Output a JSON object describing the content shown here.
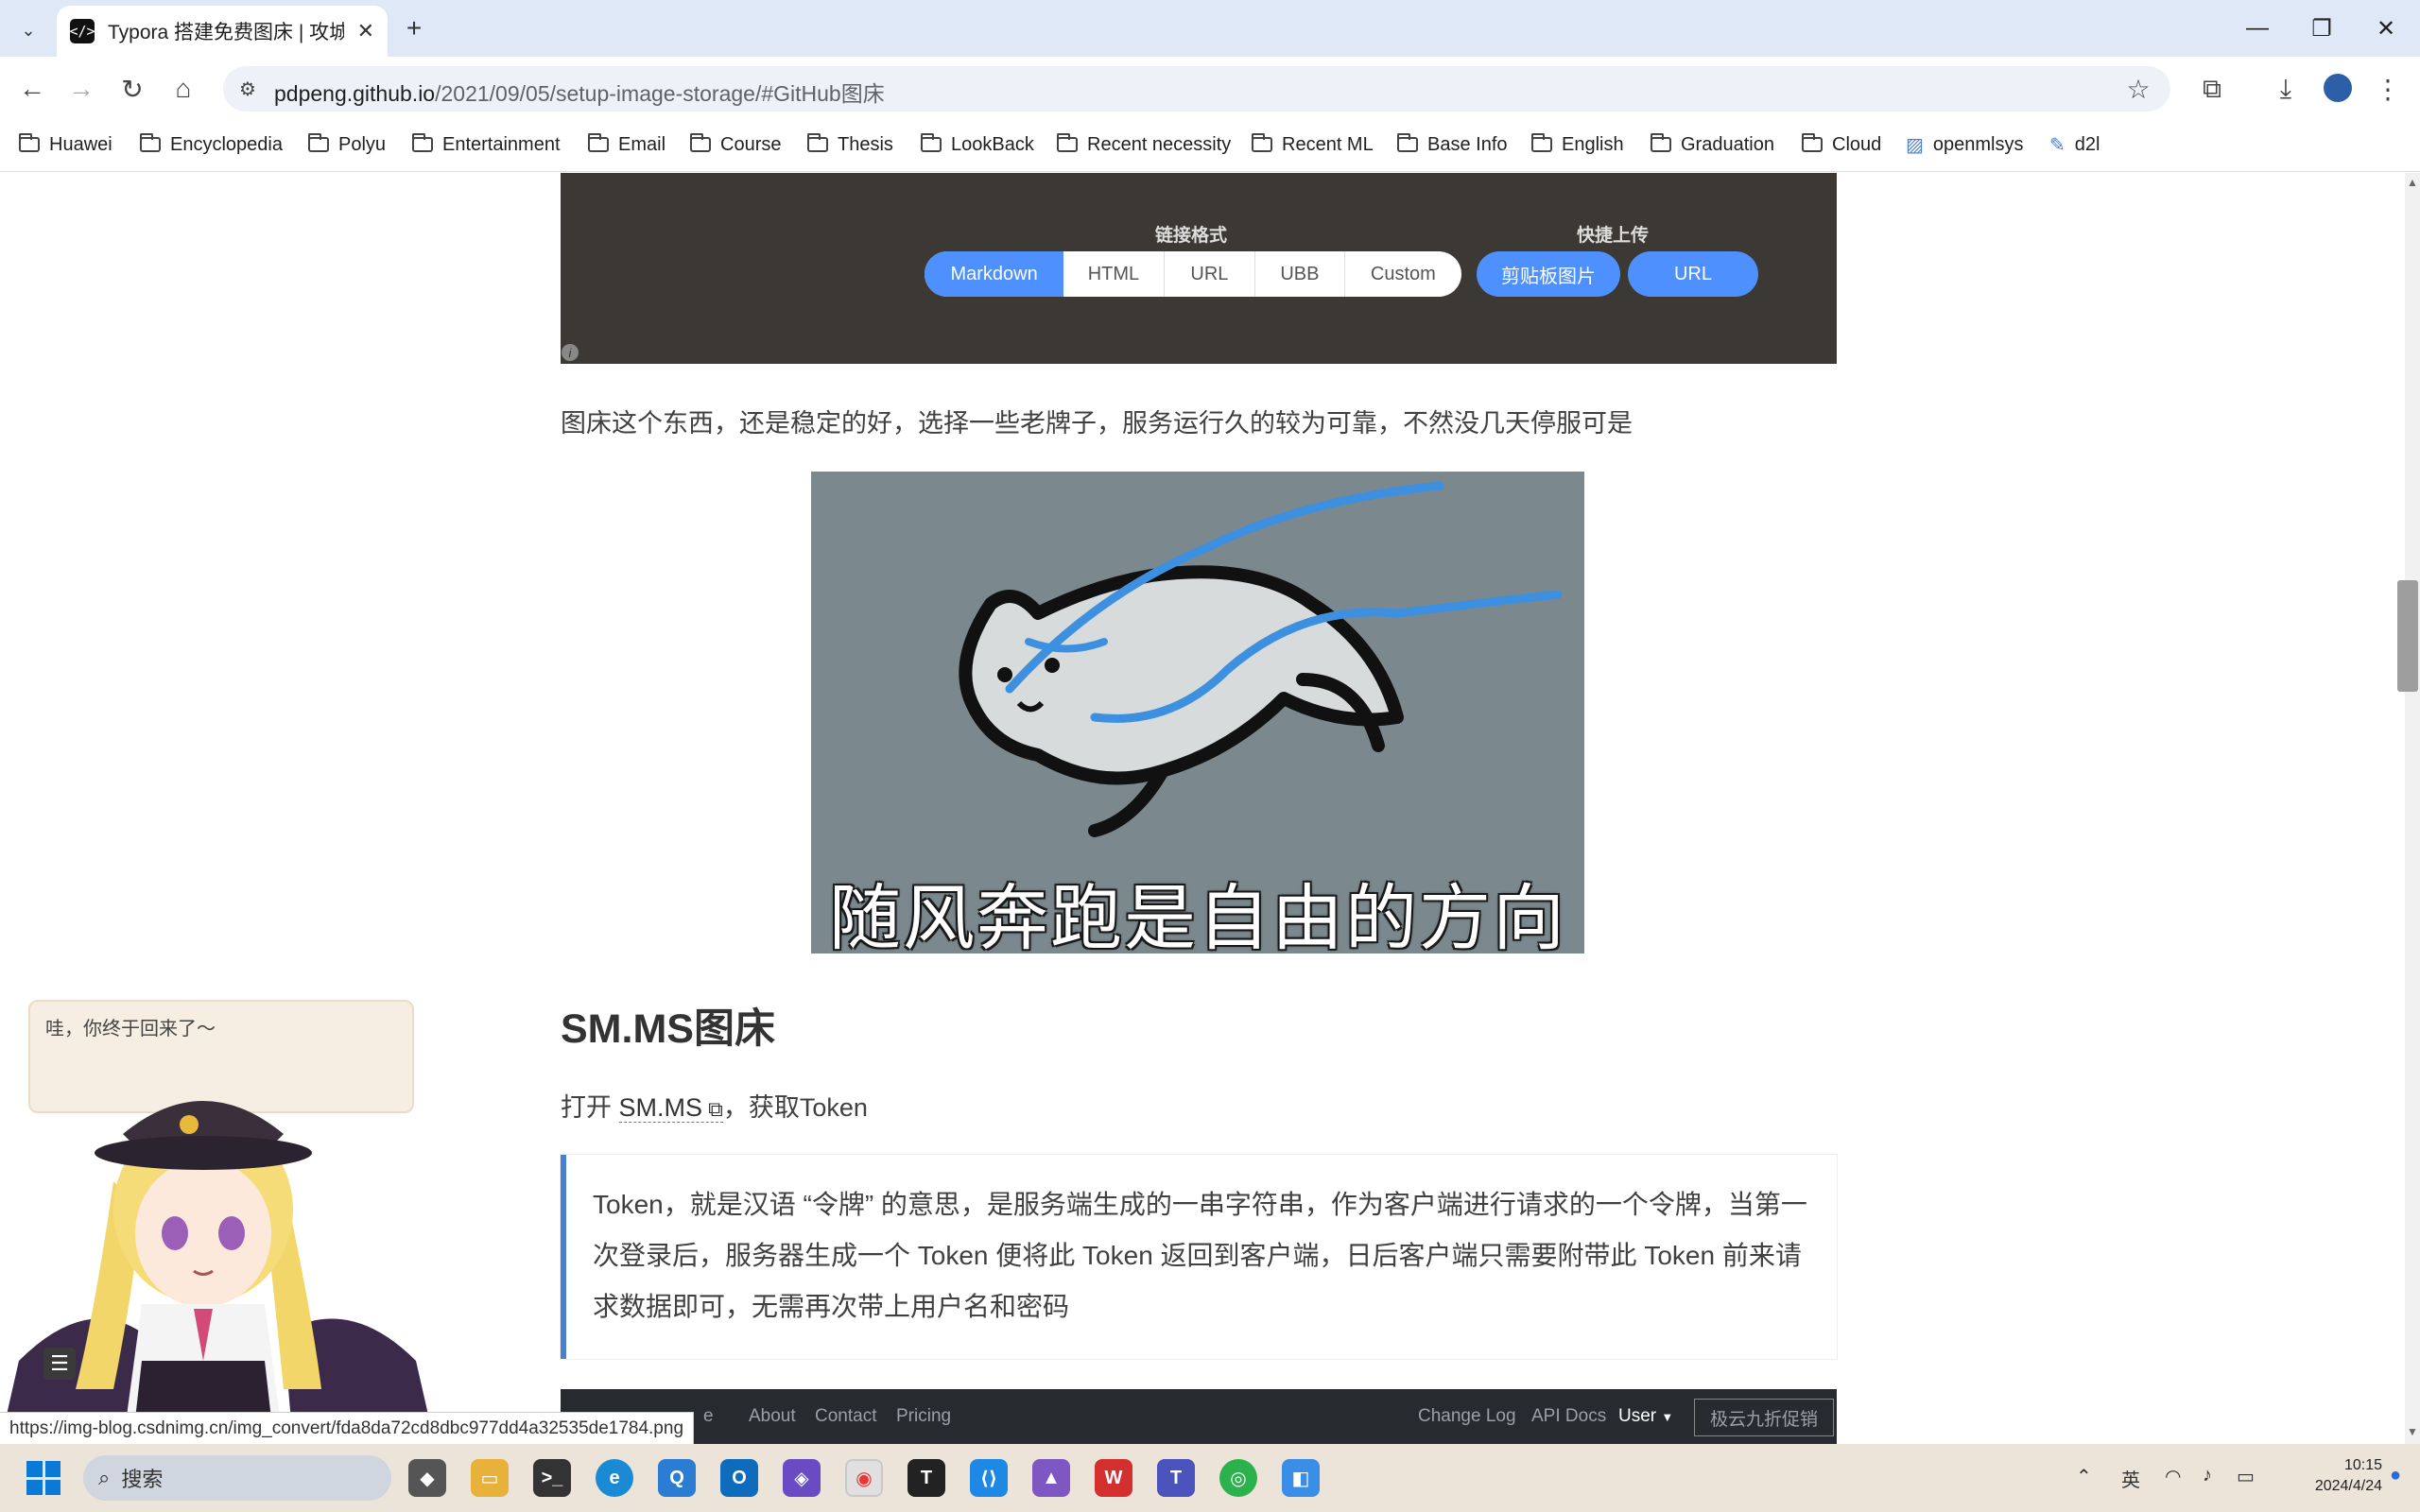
{
  "browser": {
    "tab_title": "Typora 搭建免费图床 | 攻城狮",
    "address_host": "pdpeng.github.io",
    "address_path": "/2021/09/05/setup-image-storage/#GitHub图床",
    "new_tab": "+",
    "bookmarks": [
      "Huawei",
      "Encyclopedia",
      "Polyu",
      "Entertainment",
      "Email",
      "Course",
      "Thesis",
      "LookBack",
      "Recent necessity",
      "Recent ML",
      "Base Info",
      "English",
      "Graduation",
      "Cloud",
      "openmlsys",
      "d2l"
    ]
  },
  "uploader": {
    "format_title": "链接格式",
    "format_options": [
      "Markdown",
      "HTML",
      "URL",
      "UBB",
      "Custom"
    ],
    "selected_format": "Markdown",
    "quick_title": "快捷上传",
    "quick_options": [
      "剪贴板图片",
      "URL"
    ]
  },
  "article": {
    "para1": "图床这个东西，还是稳定的好，选择一些老牌子，服务运行久的较为可靠，不然没几天停服可是",
    "meme_caption": "随风奔跑是自由的方向",
    "heading": "SM.MS图床",
    "para2_prefix": "打开",
    "para2_link": "SM.MS",
    "para2_suffix": "，获取Token",
    "quote": "Token，就是汉语 “令牌” 的意思，是服务端生成的一串字符串，作为客户端进行请求的一个令牌，当第一次登录后，服务器生成一个 Token 便将此 Token 返回到客户端，日后客户端只需要附带此 Token 前来请求数据即可，无需再次带上用户名和密码"
  },
  "embed_footer": {
    "links": [
      "e",
      "About",
      "Contact",
      "Pricing"
    ],
    "right_links": [
      "Change Log",
      "API Docs",
      "User"
    ],
    "promo": "极云九折促销"
  },
  "widget": {
    "bubble": "哇，你终于回来了～"
  },
  "status_url": "https://img-blog.csdnimg.cn/img_convert/fda8da72cd8dbc977dd4a32535de1784.png",
  "taskbar": {
    "search_placeholder": "搜索",
    "ime": "英",
    "time": "10:15",
    "date": "2024/4/24"
  },
  "colors": {
    "accent": "#4d90fe",
    "panel": "#3c3935",
    "quote_border": "#4a7fd0"
  }
}
